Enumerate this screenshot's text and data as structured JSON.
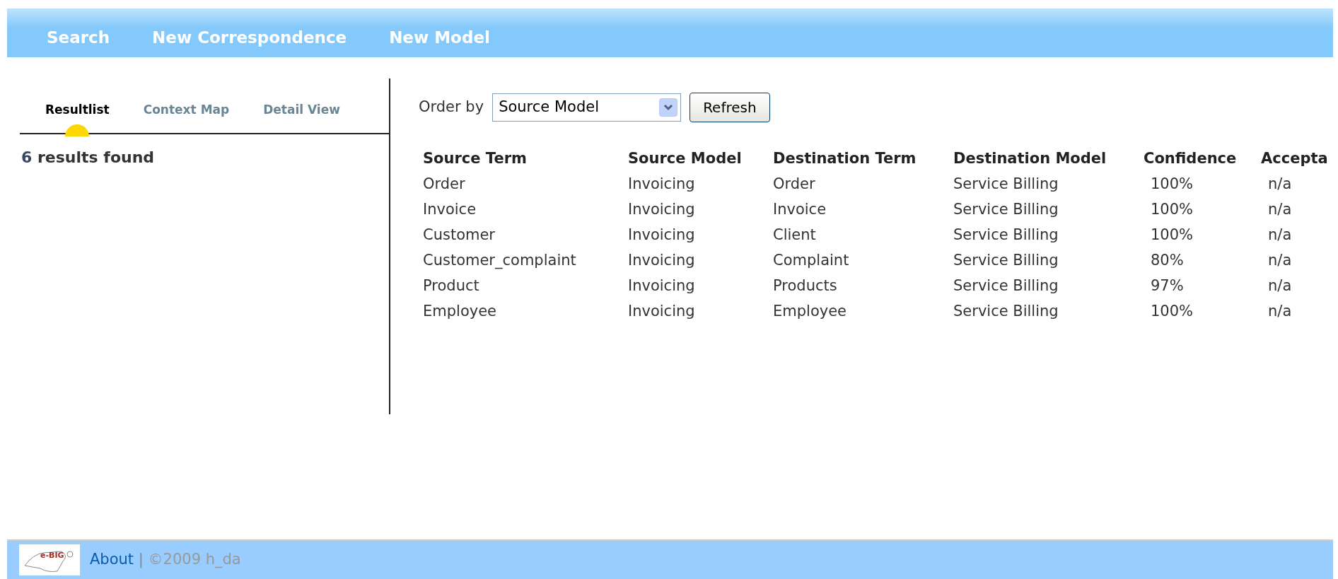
{
  "nav": [
    {
      "label": "Search"
    },
    {
      "label": "New Correspondence"
    },
    {
      "label": "New Model"
    }
  ],
  "tabs": [
    {
      "label": "Resultlist",
      "selected": true
    },
    {
      "label": "Context Map",
      "selected": false
    },
    {
      "label": "Detail View",
      "selected": false
    }
  ],
  "results": {
    "count": "6",
    "label": "results found"
  },
  "order_by": {
    "label": "Order by",
    "value": "Source Model",
    "button": "Refresh"
  },
  "table": {
    "columns": [
      "Source Term",
      "Source Model",
      "Destination Term",
      "Destination Model",
      "Confidence",
      "Accepta"
    ],
    "rows": [
      [
        "Order",
        "Invoicing",
        "Order",
        "Service Billing",
        "100%",
        "n/a"
      ],
      [
        "Invoice",
        "Invoicing",
        "Invoice",
        "Service Billing",
        "100%",
        "n/a"
      ],
      [
        "Customer",
        "Invoicing",
        "Client",
        "Service Billing",
        "100%",
        "n/a"
      ],
      [
        "Customer_complaint",
        "Invoicing",
        "Complaint",
        "Service Billing",
        "80%",
        "n/a"
      ],
      [
        "Product",
        "Invoicing",
        "Products",
        "Service Billing",
        "97%",
        "n/a"
      ],
      [
        "Employee",
        "Invoicing",
        "Employee",
        "Service Billing",
        "100%",
        "n/a"
      ]
    ]
  },
  "footer": {
    "logo_text": "e-BIG",
    "link": "About",
    "separator": "|",
    "copyright": "©2009 h_da"
  }
}
